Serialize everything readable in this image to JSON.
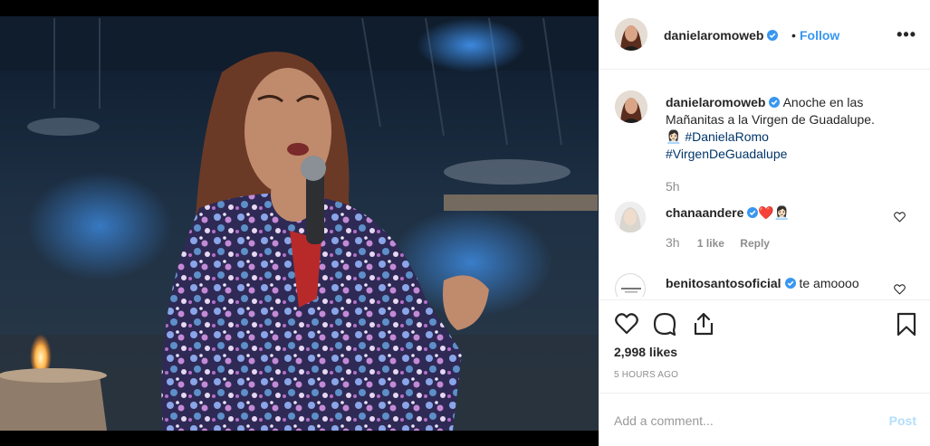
{
  "post": {
    "author": "danielaromoweb",
    "follow_label": "Follow",
    "separator": "•",
    "more_label": "•••",
    "caption_text": "Anoche en las Mañanitas a la Virgen de Guadalupe.",
    "caption_emoji": "👩🏻‍💼",
    "hashtag_1": "#DanielaRomo",
    "hashtag_2": "#VirgenDeGuadalupe",
    "caption_time": "5h",
    "likes": "2,998 likes",
    "posted_ago": "5 HOURS AGO"
  },
  "comments": [
    {
      "user": "chanaandere",
      "text": "❤️👩🏻‍💼",
      "time": "3h",
      "likes": "1 like",
      "reply": "Reply"
    },
    {
      "user": "benitosantosoficial",
      "text": "te amoooo"
    }
  ],
  "composer": {
    "placeholder": "Add a comment...",
    "post_label": "Post"
  },
  "colors": {
    "accent": "#3897f0",
    "verified": "#3897f0",
    "hashtag": "#003569",
    "post_disabled": "#b2dffc"
  },
  "icons": [
    "verified-badge-icon",
    "heart-icon",
    "comment-icon",
    "share-icon",
    "bookmark-icon",
    "more-icon"
  ]
}
